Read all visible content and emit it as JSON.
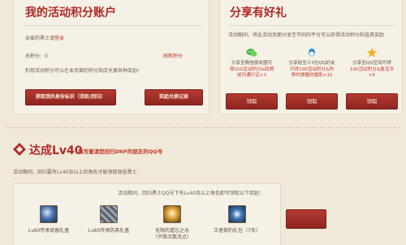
{
  "account": {
    "title": "我的活动积分账户",
    "welcome_prefix": "亲爱的勇士请",
    "welcome_link": "登录",
    "points_label": "总积分：0",
    "refresh_label": "刷新积分",
    "hint": "利用活动积分可以在本页面的积分商店兑换各种奖励!",
    "get_id_button": "获取我的身份标识（活跃/回归）",
    "records_button": "奖励兑换记录"
  },
  "share": {
    "title": "分享有好礼",
    "desc": "活动期间，将此活动页面分享至不同的平台可以获得活动积分和道具奖励",
    "cards": [
      {
        "icon": "wechat-icon",
        "line1": "分享至微信朋友圈可",
        "line2": "得100活动积分&回溯",
        "line3": "成功通行证×3",
        "button": "领取"
      },
      {
        "icon": "qq-icon",
        "line1": "分享给至少3位QQ好友",
        "line2": "可得100活动积分&异",
        "line3": "界的馈赠的援助×10",
        "button": "领取"
      },
      {
        "icon": "qzone-star-icon",
        "line1": "分享至QQ空间可得",
        "line2": "100活动积分&复活币",
        "line3": "×5",
        "button": "领取"
      }
    ]
  },
  "level": {
    "title": "达成Lv40",
    "link": "填写邀请您回归DNF的朋友的QQ号",
    "desc": "活动期间，回归要有Lv40及以上的角色才能领取现役勇士",
    "reward_desc": "活动期间，回归勇士QQ号下有Lv40及以上角色即可领取以下奖励：",
    "rewards": [
      {
        "name": "Lv60传承武器礼盒"
      },
      {
        "name": "Lv60传承防具礼盒"
      },
      {
        "name_line1": "无限的遗忘之水",
        "name_line2": "（不限次数洗点）"
      },
      {
        "name": "王者契约礼包（7天）"
      }
    ]
  }
}
